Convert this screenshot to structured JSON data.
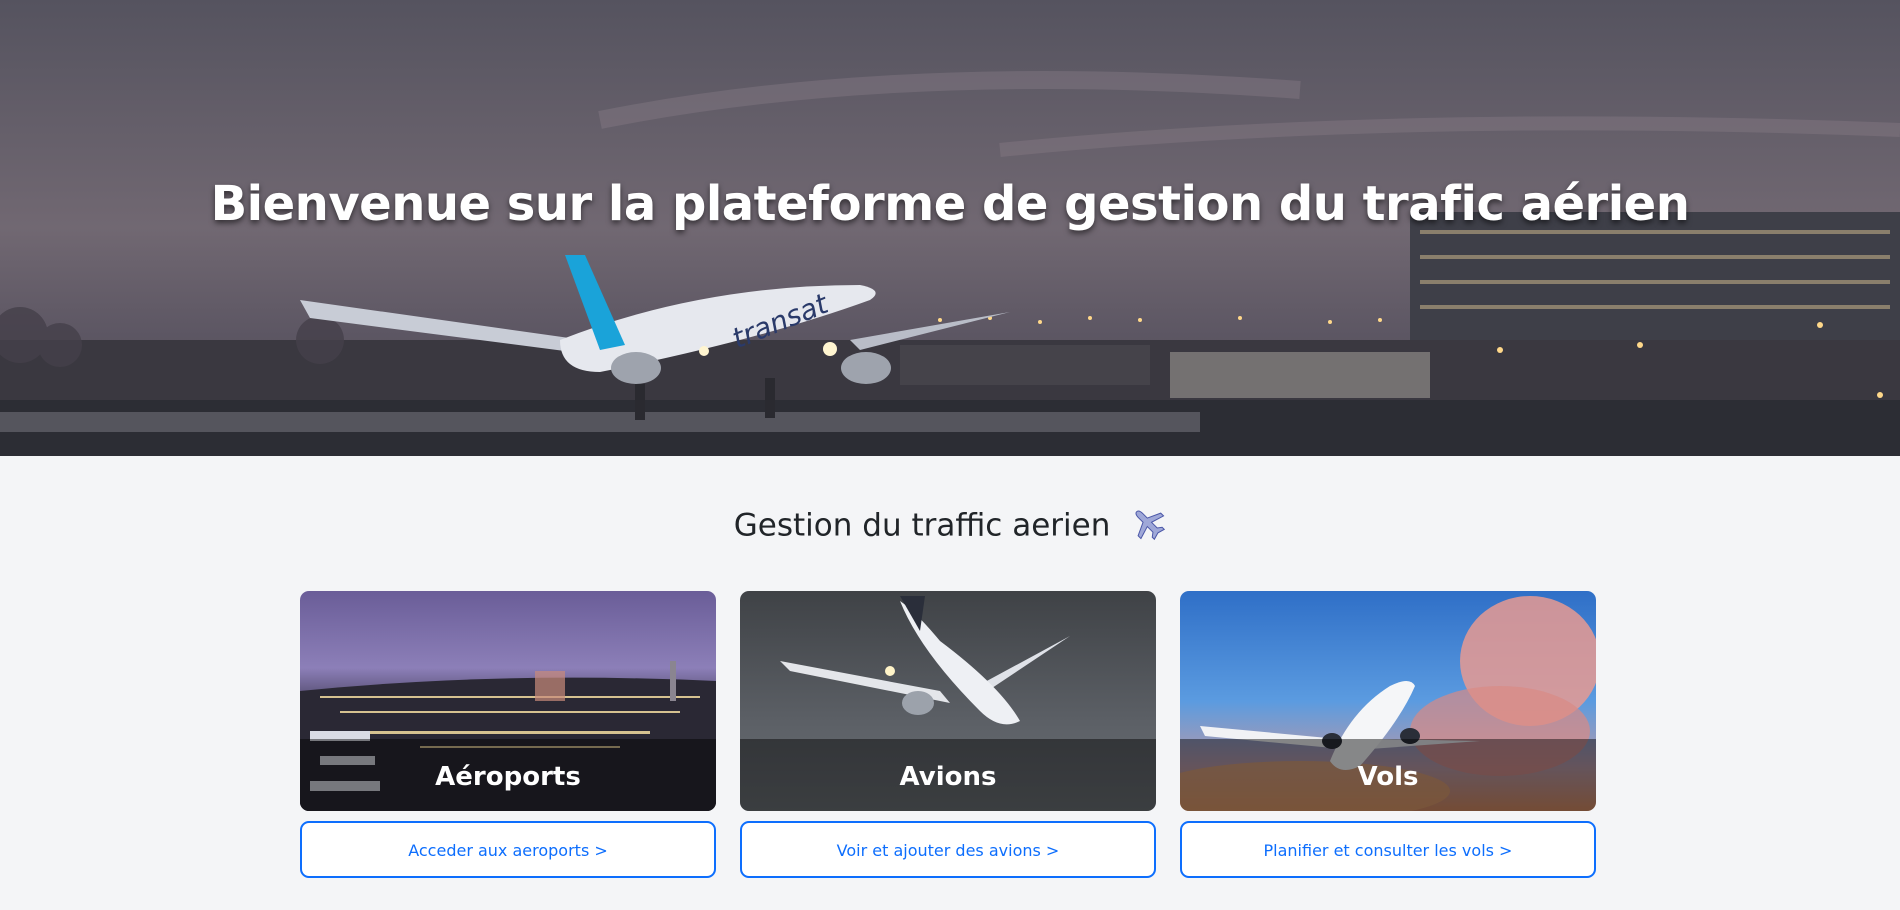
{
  "hero": {
    "title": "Bienvenue sur la plateforme de gestion du trafic aérien"
  },
  "section": {
    "title": "Gestion du traffic aerien",
    "icon": "airplane-icon"
  },
  "cards": [
    {
      "caption": "Aéroports",
      "button_label": "Acceder aux aeroports >"
    },
    {
      "caption": "Avions",
      "button_label": "Voir et ajouter des avions >"
    },
    {
      "caption": "Vols",
      "button_label": "Planifier et consulter les vols >"
    }
  ],
  "colors": {
    "primary": "#0d6efd",
    "background": "#f4f5f7",
    "text": "#212529"
  }
}
